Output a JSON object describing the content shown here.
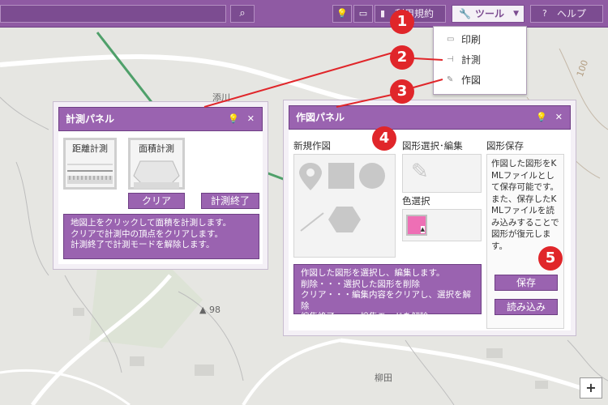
{
  "topbar": {
    "search_placeholder": "",
    "search_icon": "search-icon",
    "terms_label": "利用規約",
    "tools_label": "ツール",
    "help_label": "ヘルプ"
  },
  "tools_menu": {
    "items": [
      {
        "label": "印刷",
        "icon": "print-icon"
      },
      {
        "label": "計測",
        "icon": "measure-icon"
      },
      {
        "label": "作図",
        "icon": "draw-icon"
      }
    ]
  },
  "map": {
    "labels": {
      "place1": "添川",
      "place2": "柳田",
      "elevation": "98",
      "contour": "100"
    }
  },
  "measure_panel": {
    "title": "計測パネル",
    "distance_label": "距離計測",
    "area_label": "面積計測",
    "clear_label": "クリア",
    "end_label": "計測終了",
    "info_lines": [
      "地図上をクリックして面積を計測します。",
      "クリアで計測中の頂点をクリアします。",
      "計測終了で計測モードを解除します。"
    ]
  },
  "draw_panel": {
    "title": "作図パネル",
    "new_drawing_label": "新規作図",
    "select_edit_label": "図形選択･編集",
    "color_select_label": "色選択",
    "save_section_label": "図形保存",
    "save_description": "作図した図形をKMLファイルとして保存可能です。また、保存したKMLファイルを読み込みすることで図形が復元します。",
    "save_button": "保存",
    "load_button": "読み込み",
    "info_lines": [
      "作図した図形を選択し、編集します。",
      "削除・・・選択した図形を削除",
      "クリア・・・編集内容をクリアし、選択を解除",
      "編集終了・・・編集モードを解除"
    ],
    "swatch_color": "#ee6fb5"
  },
  "callouts": [
    "1",
    "2",
    "3",
    "4",
    "5"
  ],
  "zoom": {
    "plus": "+"
  },
  "colors": {
    "accent": "#9a63b0",
    "callout": "#e0262a"
  }
}
